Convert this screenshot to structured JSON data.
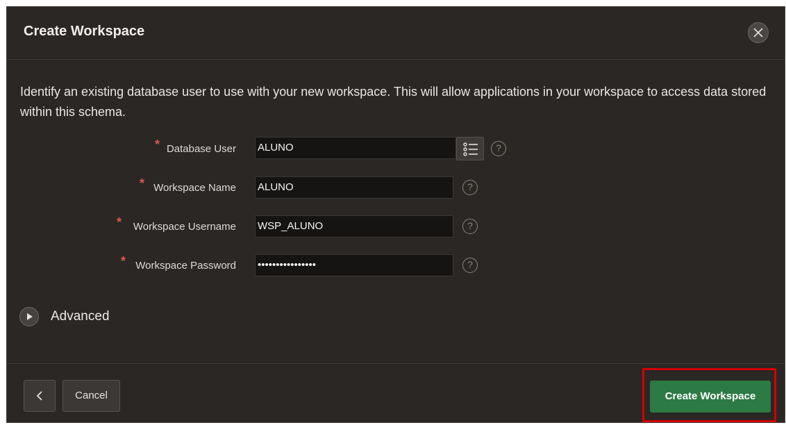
{
  "dialog": {
    "title": "Create Workspace",
    "close_icon": "close-icon"
  },
  "description": "Identify an existing database user to use with your new workspace. This will allow applications in your workspace to access data stored within this schema.",
  "fields": {
    "database_user": {
      "label": "Database User",
      "value": "ALUNO",
      "required": true,
      "lov_icon": "list-icon",
      "help_icon": "help-icon"
    },
    "workspace_name": {
      "label": "Workspace Name",
      "value": "ALUNO",
      "required": true,
      "help_icon": "help-icon"
    },
    "workspace_username": {
      "label": "Workspace Username",
      "value": "WSP_ALUNO",
      "required": true,
      "help_icon": "help-icon"
    },
    "workspace_password": {
      "label": "Workspace Password",
      "value": "••••••••••••••••",
      "required": true,
      "help_icon": "help-icon"
    }
  },
  "required_marker": "*",
  "help_glyph": "?",
  "advanced": {
    "label": "Advanced",
    "icon": "play-icon"
  },
  "footer": {
    "back_icon": "chevron-left-icon",
    "cancel_label": "Cancel",
    "create_label": "Create Workspace"
  },
  "colors": {
    "dialog_bg": "#2a2725",
    "primary_button": "#2c7a44",
    "required_marker": "#e0564a",
    "highlight_box": "#d40000"
  }
}
